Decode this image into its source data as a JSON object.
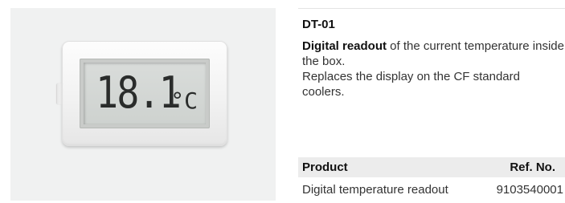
{
  "product": {
    "model": "DT-01",
    "description_bold": "Digital readout",
    "description_rest": " of the current temperature inside the box.",
    "description_line2": "Replaces the display on the CF standard coolers."
  },
  "display": {
    "reading": "18.1",
    "unit": "°C"
  },
  "table": {
    "header_product": "Product",
    "header_ref": "Ref. No.",
    "rows": [
      {
        "product": "Digital temperature readout",
        "ref": "9103540001"
      }
    ]
  }
}
